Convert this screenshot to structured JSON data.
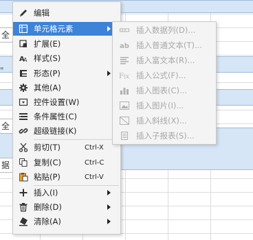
{
  "sheet": {
    "edge_cells": [
      "全",
      "全",
      "据"
    ],
    "edge_marks": [
      "\"",
      "\""
    ]
  },
  "menu": {
    "items": [
      {
        "label": "编辑",
        "shortcut": "",
        "submenu": false,
        "active": false,
        "icon": "pencil-icon"
      },
      {
        "label": "单元格元素",
        "shortcut": "",
        "submenu": true,
        "active": true,
        "icon": "cell-element-icon"
      },
      {
        "label": "扩展(E)",
        "shortcut": "",
        "submenu": false,
        "active": false,
        "icon": "expand-icon"
      },
      {
        "label": "样式(S)",
        "shortcut": "",
        "submenu": false,
        "active": false,
        "icon": "style-icon"
      },
      {
        "label": "形态(P)",
        "shortcut": "",
        "submenu": true,
        "active": false,
        "icon": "form-icon"
      },
      {
        "label": "其他(A)",
        "shortcut": "",
        "submenu": false,
        "active": false,
        "icon": "gear-icon"
      },
      {
        "label": "控件设置(W)",
        "shortcut": "",
        "submenu": false,
        "active": false,
        "icon": "widget-icon"
      },
      {
        "label": "条件属性(C)",
        "shortcut": "",
        "submenu": false,
        "active": false,
        "icon": "condition-icon"
      },
      {
        "label": "超级链接(K)",
        "shortcut": "",
        "submenu": false,
        "active": false,
        "icon": "link-icon"
      },
      {
        "label": "剪切(T)",
        "shortcut": "Ctrl-X",
        "submenu": false,
        "active": false,
        "icon": "scissors-icon"
      },
      {
        "label": "复制(C)",
        "shortcut": "Ctrl-C",
        "submenu": false,
        "active": false,
        "icon": "copy-icon"
      },
      {
        "label": "粘贴(P)",
        "shortcut": "Ctrl-V",
        "submenu": false,
        "active": false,
        "icon": "paste-icon"
      },
      {
        "label": "插入(I)",
        "shortcut": "",
        "submenu": true,
        "active": false,
        "icon": "plus-icon"
      },
      {
        "label": "删除(D)",
        "shortcut": "",
        "submenu": true,
        "active": false,
        "icon": "trash-icon"
      },
      {
        "label": "清除(A)",
        "shortcut": "",
        "submenu": true,
        "active": false,
        "icon": "eraser-icon"
      }
    ]
  },
  "submenu": {
    "items": [
      {
        "label": "插入数据列(D)...",
        "icon": "data-column-icon",
        "enabled": false
      },
      {
        "label": "插入普通文本(T)...",
        "icon": "text-icon",
        "enabled": false
      },
      {
        "label": "插入富文本(R)...",
        "icon": "rich-text-icon",
        "enabled": false
      },
      {
        "label": "插入公式(F)...",
        "icon": "formula-icon",
        "enabled": false
      },
      {
        "label": "插入图表(C)...",
        "icon": "chart-icon",
        "enabled": false
      },
      {
        "label": "插入图片(I)...",
        "icon": "image-icon",
        "enabled": false
      },
      {
        "label": "插入斜线(X)...",
        "icon": "slash-icon",
        "enabled": false
      },
      {
        "label": "插入子报表(S)...",
        "icon": "sub-report-icon",
        "enabled": false
      }
    ]
  },
  "colors": {
    "highlight": "#3d83d8",
    "menu_bg": "#f4f4f4",
    "disabled_text": "#a8a8a8",
    "sheet_band": "#d6e6f7"
  }
}
